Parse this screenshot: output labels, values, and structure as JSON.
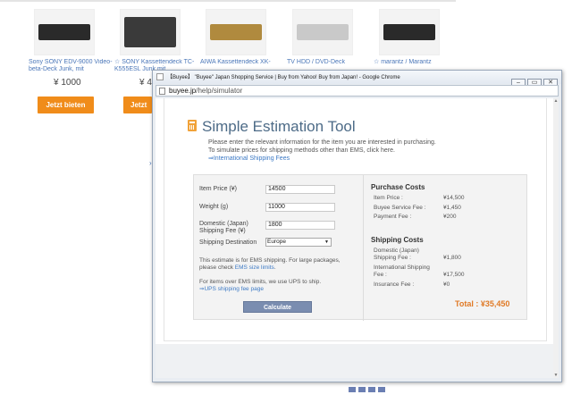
{
  "background_page": {
    "products": [
      {
        "title": "Sony SONY EDV-9000 Video-beta-Deck Junk, mit",
        "price": "¥ 1000",
        "bid_label": "Jetzt bieten"
      },
      {
        "title": "☆ SONY Kassettendeck TC-K555ESL Junk mit",
        "price": "¥ 4",
        "bid_label": "Jetzt"
      },
      {
        "title": "AIWA Kassettendeck XK-",
        "price": "",
        "bid_label": ""
      },
      {
        "title": "TV HDD / DVD-Deck",
        "price": "",
        "bid_label": ""
      },
      {
        "title": "☆ marantz / Marantz",
        "price": "",
        "bid_label": ""
      }
    ]
  },
  "window": {
    "title": "【Buyee】 \"Buyee\" Japan Shopping Service | Buy from Yahoo! Buy from Japan! - Google Chrome",
    "controls": {
      "minimize": "–",
      "maximize": "▭",
      "close": "✕"
    },
    "url_domain": "buyee.jp",
    "url_path": "/help/simulator"
  },
  "tool": {
    "icon": "calculator-icon",
    "title": "Simple Estimation Tool",
    "intro_line1": "Please enter the relevant information for the item you are interested in purchasing.",
    "intro_line2": "To simulate prices for shipping methods other than EMS, click here.",
    "intro_link": "⇒International Shipping Fees"
  },
  "form": {
    "item_price_label": "Item Price (¥)",
    "item_price_value": "14500",
    "weight_label": "Weight (g)",
    "weight_value": "11000",
    "domestic_fee_label_line1": "Domestic (Japan)",
    "domestic_fee_label_line2": "Shipping Fee (¥)",
    "domestic_fee_value": "1800",
    "destination_label": "Shipping Destination",
    "destination_value": "Europe",
    "ems_note_prefix": "This estimate is for EMS shipping. For large packages, please check ",
    "ems_note_link": "EMS size limits",
    "ems_note_suffix": ".",
    "ups_note": "For items over EMS limits, we use UPS to ship.",
    "ups_link": "⇒UPS shipping fee page",
    "calculate_label": "Calculate"
  },
  "results": {
    "purchase_costs_title": "Purchase Costs",
    "item_price_label": "Item Price :",
    "item_price_value": "¥14,500",
    "service_fee_label": "Buyee Service Fee :",
    "service_fee_value": "¥1,450",
    "payment_fee_label": "Payment Fee :",
    "payment_fee_value": "¥200",
    "shipping_costs_title": "Shipping Costs",
    "domestic_label_line1": "Domestic (Japan)",
    "domestic_label_line2": "Shipping Fee :",
    "domestic_value": "¥1,800",
    "international_label_line1": "International Shipping",
    "international_label_line2": "Fee :",
    "international_value": "¥17,500",
    "insurance_label": "Insurance Fee :",
    "insurance_value": "¥0",
    "total": "Total : ¥35,450"
  },
  "colors": {
    "accent_orange": "#e07a26",
    "bid_button": "#f08c1a",
    "title_blue": "#4d6b87",
    "link_blue": "#3d7ac5",
    "calculate_button": "#7a8db0"
  }
}
